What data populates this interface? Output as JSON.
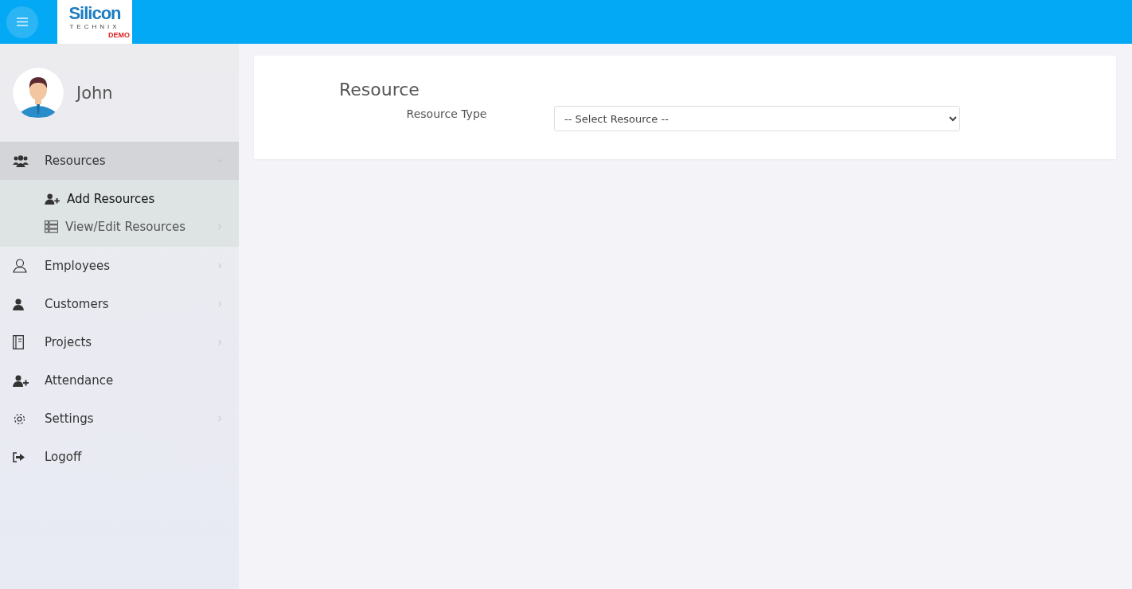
{
  "logo": {
    "name": "Silicon",
    "tagline": "TECHNIX",
    "badge": "DEMO"
  },
  "user": {
    "name": "John"
  },
  "menu": [
    {
      "label": "Resources",
      "kind": "users",
      "expanded": true,
      "selected": true,
      "children": [
        {
          "label": "Add Resources",
          "kind": "user-plus",
          "selected": true
        },
        {
          "label": "View/Edit Resources",
          "kind": "list",
          "selected": false,
          "expanded": false
        }
      ]
    },
    {
      "label": "Employees",
      "kind": "user-outline",
      "expanded": false,
      "selected": false
    },
    {
      "label": "Customers",
      "kind": "user",
      "expanded": false,
      "selected": false
    },
    {
      "label": "Projects",
      "kind": "book",
      "expanded": false,
      "selected": false
    },
    {
      "label": "Attendance",
      "kind": "user-plus",
      "selected": false
    },
    {
      "label": "Settings",
      "kind": "gear",
      "expanded": false,
      "selected": false
    },
    {
      "label": "Logoff",
      "kind": "logout",
      "selected": false
    }
  ],
  "form": {
    "title": "Resource",
    "field_label": "Resource Type",
    "select_value": "-- Select Resource --"
  }
}
